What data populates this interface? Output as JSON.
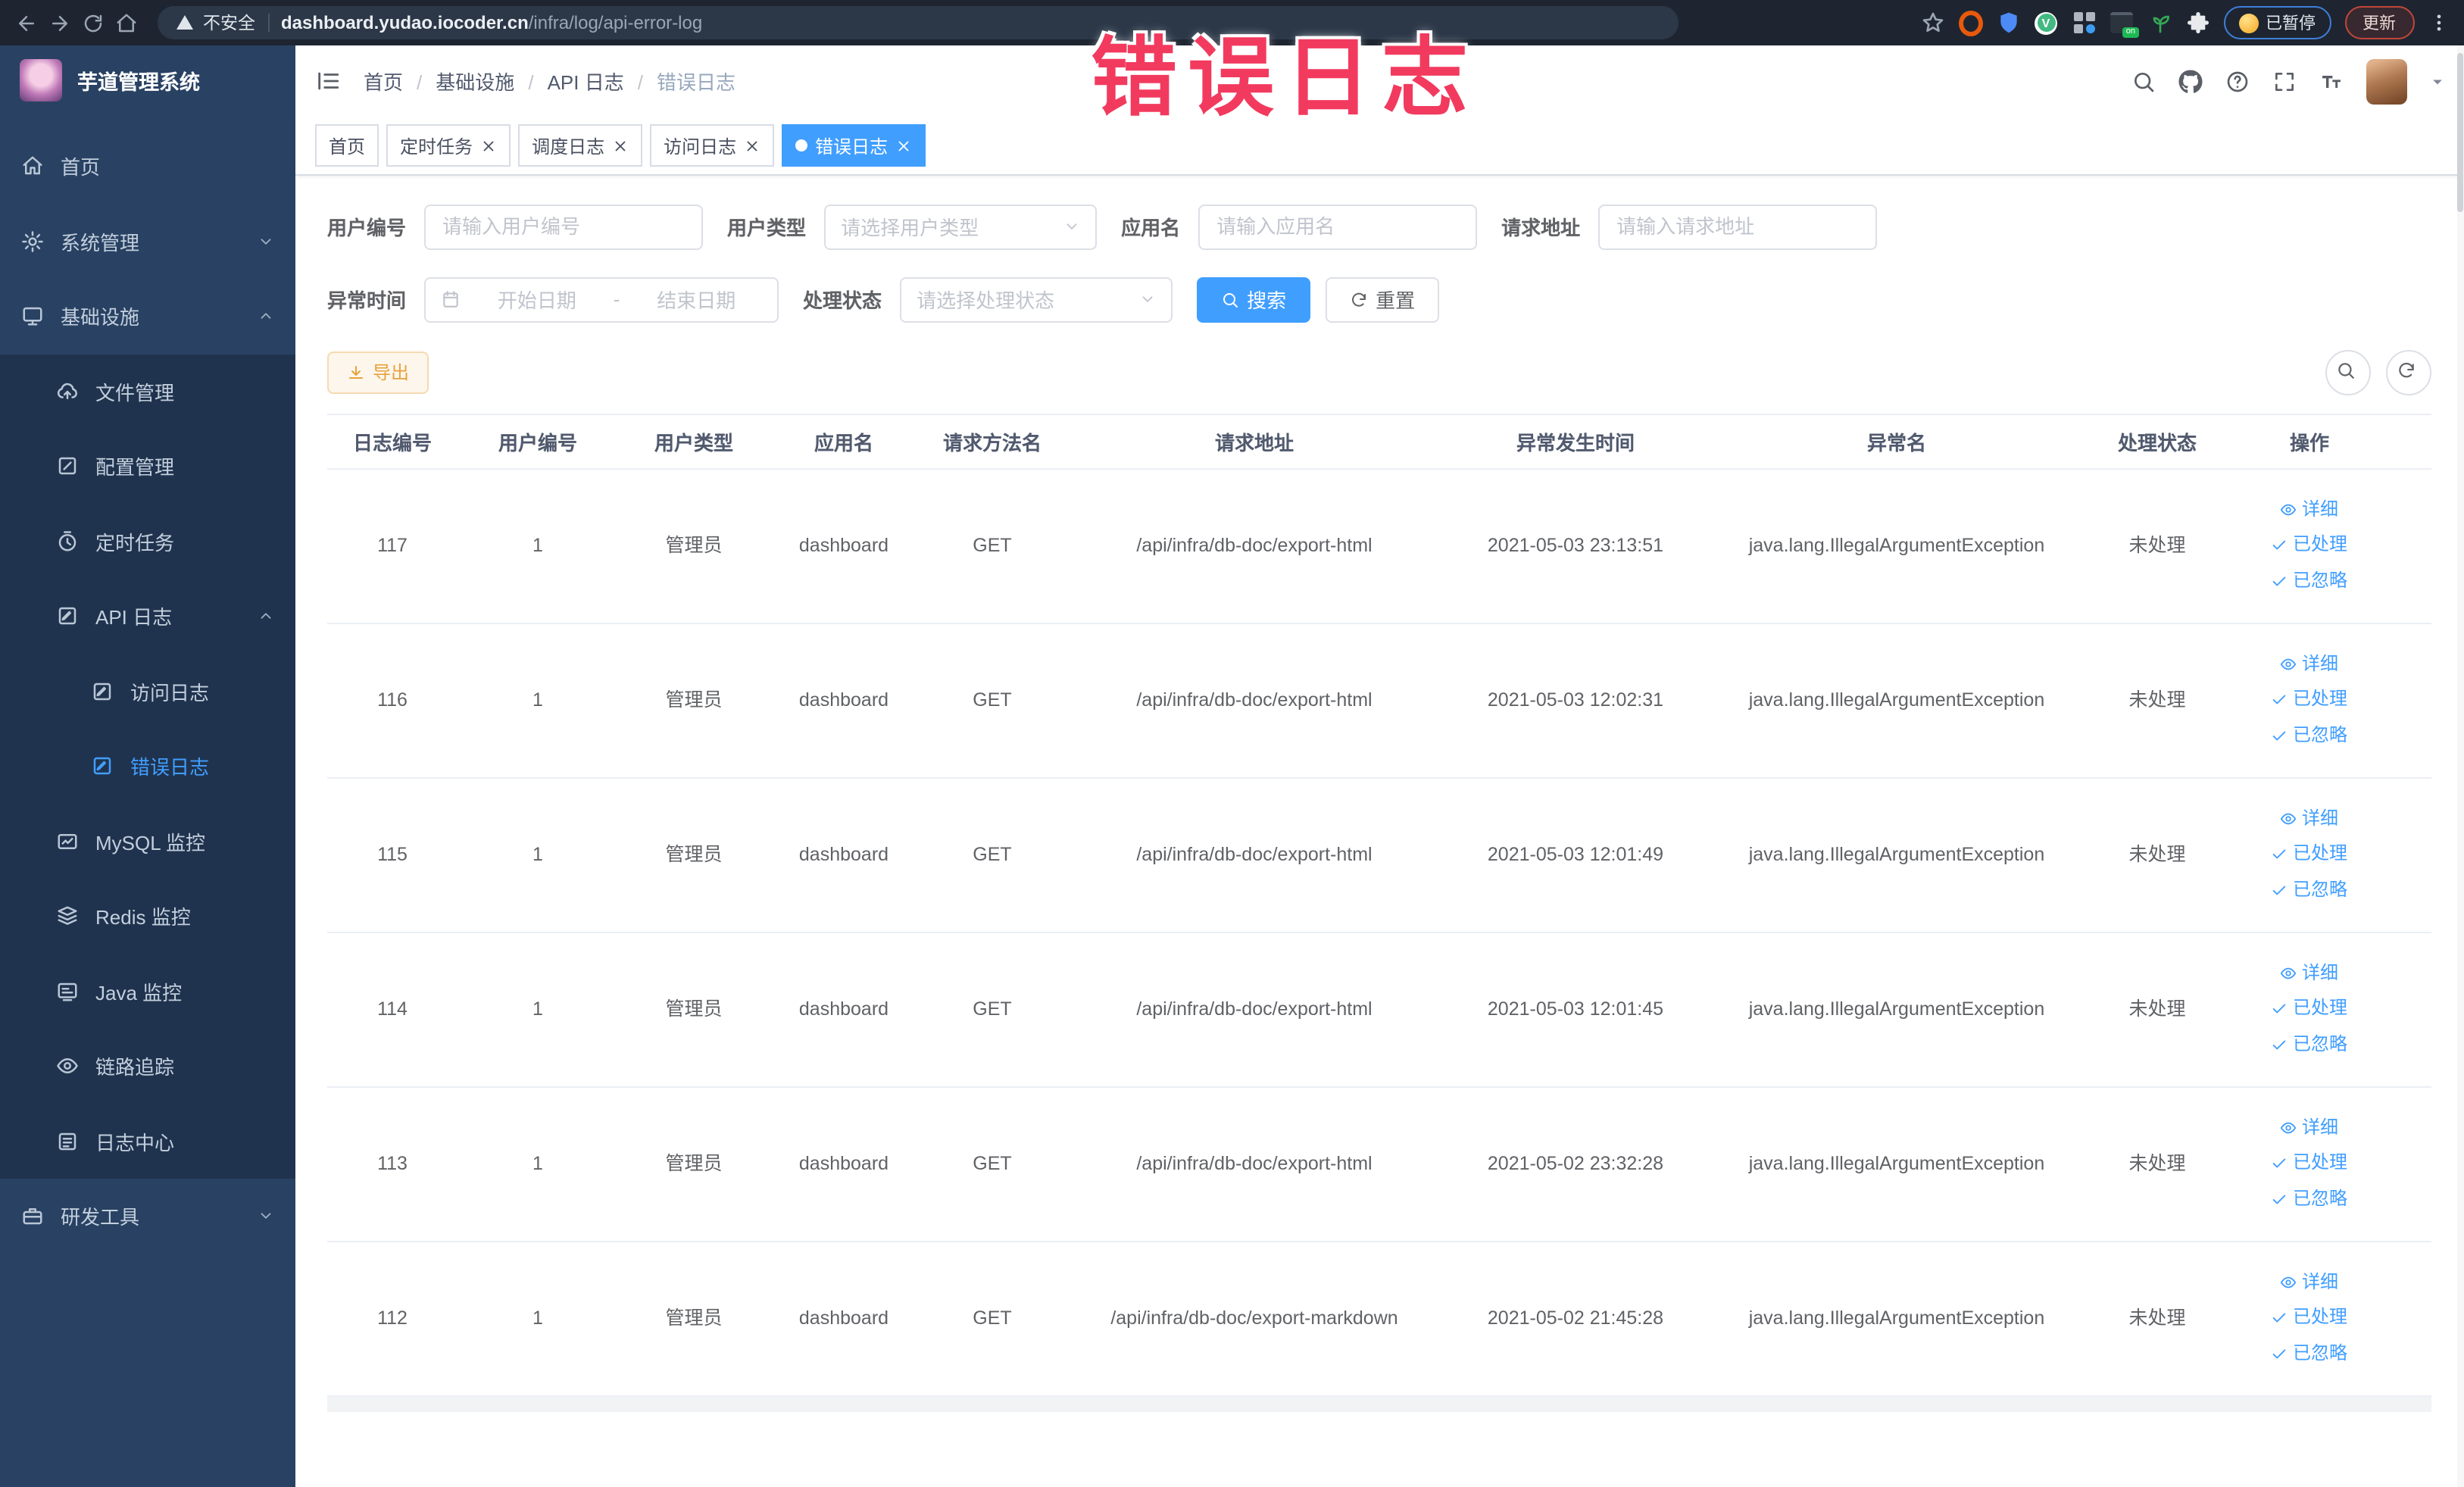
{
  "annotation": {
    "title": "错误日志"
  },
  "browser": {
    "security_label": "不安全",
    "url_host": "dashboard.yudao.iocoder.cn",
    "url_path": "/infra/log/api-error-log",
    "extension_on_badge": "on",
    "paused_badge_label": "已暂停",
    "update_button_label": "更新"
  },
  "sidebar": {
    "logo_title": "芋道管理系统",
    "items": [
      {
        "label": "首页",
        "icon": "home-icon",
        "level": 0
      },
      {
        "label": "系统管理",
        "icon": "gear-icon",
        "level": 0,
        "chevron_icon": "chevron-down-icon"
      },
      {
        "label": "基础设施",
        "icon": "monitor-icon",
        "level": 0,
        "chevron_icon": "chevron-up-icon"
      },
      {
        "label": "文件管理",
        "icon": "cloud-upload-icon",
        "level": 1,
        "sub": true
      },
      {
        "label": "配置管理",
        "icon": "edit-square-icon",
        "level": 1,
        "sub": true
      },
      {
        "label": "定时任务",
        "icon": "timer-icon",
        "level": 1,
        "sub": true
      },
      {
        "label": "API 日志",
        "icon": "doc-log-icon",
        "level": 1,
        "sub": true,
        "chevron_icon": "chevron-up-icon"
      },
      {
        "label": "访问日志",
        "icon": "doc-log-icon",
        "level": 2,
        "sub": true
      },
      {
        "label": "错误日志",
        "icon": "doc-log-icon",
        "level": 2,
        "sub": true,
        "active": true
      },
      {
        "label": "MySQL 监控",
        "icon": "mysql-monitor-icon",
        "level": 1,
        "sub": true
      },
      {
        "label": "Redis 监控",
        "icon": "redis-monitor-icon",
        "level": 1,
        "sub": true
      },
      {
        "label": "Java 监控",
        "icon": "java-monitor-icon",
        "level": 1,
        "sub": true
      },
      {
        "label": "链路追踪",
        "icon": "trace-eye-icon",
        "level": 1,
        "sub": true
      },
      {
        "label": "日志中心",
        "icon": "log-center-icon",
        "level": 1,
        "sub": true
      },
      {
        "label": "研发工具",
        "icon": "devtools-icon",
        "level": 0,
        "chevron_icon": "chevron-down-icon"
      }
    ]
  },
  "breadcrumb": [
    "首页",
    "基础设施",
    "API 日志",
    "错误日志"
  ],
  "tabs": [
    {
      "label": "首页"
    },
    {
      "label": "定时任务",
      "closable": true
    },
    {
      "label": "调度日志",
      "closable": true
    },
    {
      "label": "访问日志",
      "closable": true
    },
    {
      "label": "错误日志",
      "closable": true,
      "active": true
    }
  ],
  "filters": {
    "user_id": {
      "label": "用户编号",
      "placeholder": "请输入用户编号"
    },
    "user_type": {
      "label": "用户类型",
      "placeholder": "请选择用户类型"
    },
    "app_name": {
      "label": "应用名",
      "placeholder": "请输入应用名"
    },
    "request_url": {
      "label": "请求地址",
      "placeholder": "请输入请求地址"
    },
    "exception_time": {
      "label": "异常时间",
      "start_placeholder": "开始日期",
      "range_separator": "-",
      "end_placeholder": "结束日期"
    },
    "process_status": {
      "label": "处理状态",
      "placeholder": "请选择处理状态"
    },
    "search_button": "搜索",
    "reset_button": "重置"
  },
  "toolbar": {
    "export_button": "导出"
  },
  "table": {
    "columns": [
      "日志编号",
      "用户编号",
      "用户类型",
      "应用名",
      "请求方法名",
      "请求地址",
      "异常发生时间",
      "异常名",
      "处理状态",
      "操作"
    ],
    "rows": [
      {
        "id": "117",
        "user_id": "1",
        "user_type": "管理员",
        "app_name": "dashboard",
        "method": "GET",
        "url": "/api/infra/db-doc/export-html",
        "time": "2021-05-03 23:13:51",
        "exception": "java.lang.IllegalArgumentException",
        "status": "未处理"
      },
      {
        "id": "116",
        "user_id": "1",
        "user_type": "管理员",
        "app_name": "dashboard",
        "method": "GET",
        "url": "/api/infra/db-doc/export-html",
        "time": "2021-05-03 12:02:31",
        "exception": "java.lang.IllegalArgumentException",
        "status": "未处理"
      },
      {
        "id": "115",
        "user_id": "1",
        "user_type": "管理员",
        "app_name": "dashboard",
        "method": "GET",
        "url": "/api/infra/db-doc/export-html",
        "time": "2021-05-03 12:01:49",
        "exception": "java.lang.IllegalArgumentException",
        "status": "未处理"
      },
      {
        "id": "114",
        "user_id": "1",
        "user_type": "管理员",
        "app_name": "dashboard",
        "method": "GET",
        "url": "/api/infra/db-doc/export-html",
        "time": "2021-05-03 12:01:45",
        "exception": "java.lang.IllegalArgumentException",
        "status": "未处理"
      },
      {
        "id": "113",
        "user_id": "1",
        "user_type": "管理员",
        "app_name": "dashboard",
        "method": "GET",
        "url": "/api/infra/db-doc/export-html",
        "time": "2021-05-02 23:32:28",
        "exception": "java.lang.IllegalArgumentException",
        "status": "未处理"
      },
      {
        "id": "112",
        "user_id": "1",
        "user_type": "管理员",
        "app_name": "dashboard",
        "method": "GET",
        "url": "/api/infra/db-doc/export-markdown",
        "time": "2021-05-02 21:45:28",
        "exception": "java.lang.IllegalArgumentException",
        "status": "未处理"
      }
    ]
  },
  "row_actions": {
    "detail": "详细",
    "processed": "已处理",
    "ignored": "已忽略"
  }
}
